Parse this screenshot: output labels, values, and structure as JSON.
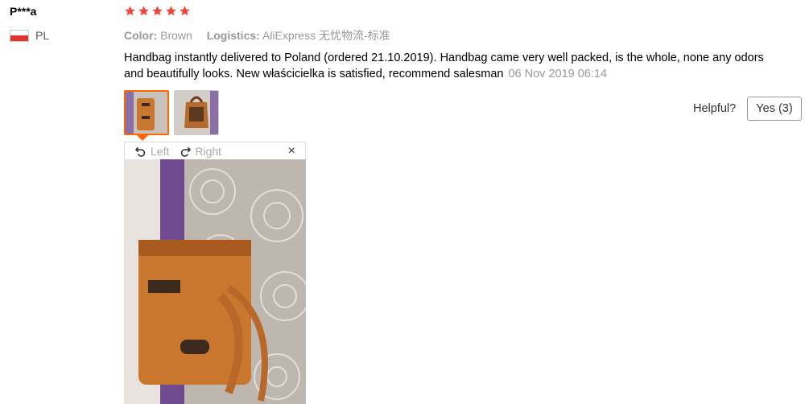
{
  "user": {
    "name": "P***a",
    "country_code": "PL"
  },
  "rating": {
    "stars": 5,
    "max": 5,
    "color": "#f44336"
  },
  "meta": {
    "color_label": "Color:",
    "color_value": "Brown",
    "logistics_label": "Logistics:",
    "logistics_value": "AliExpress 无忧物流-标准"
  },
  "review": {
    "text": "Handbag instantly delivered to Poland (ordered 21.10.2019). Handbag came very well packed, is the whole, none any odors and beautifully looks. New właścicielka is satisfied, recommend salesman",
    "date": "06 Nov 2019 06:14"
  },
  "viewer": {
    "left_label": "Left",
    "right_label": "Right",
    "close_glyph": "×"
  },
  "helpful": {
    "label": "Helpful?",
    "yes_label": "Yes (3)"
  },
  "colors": {
    "accent": "#ff6600",
    "muted": "#999999"
  }
}
